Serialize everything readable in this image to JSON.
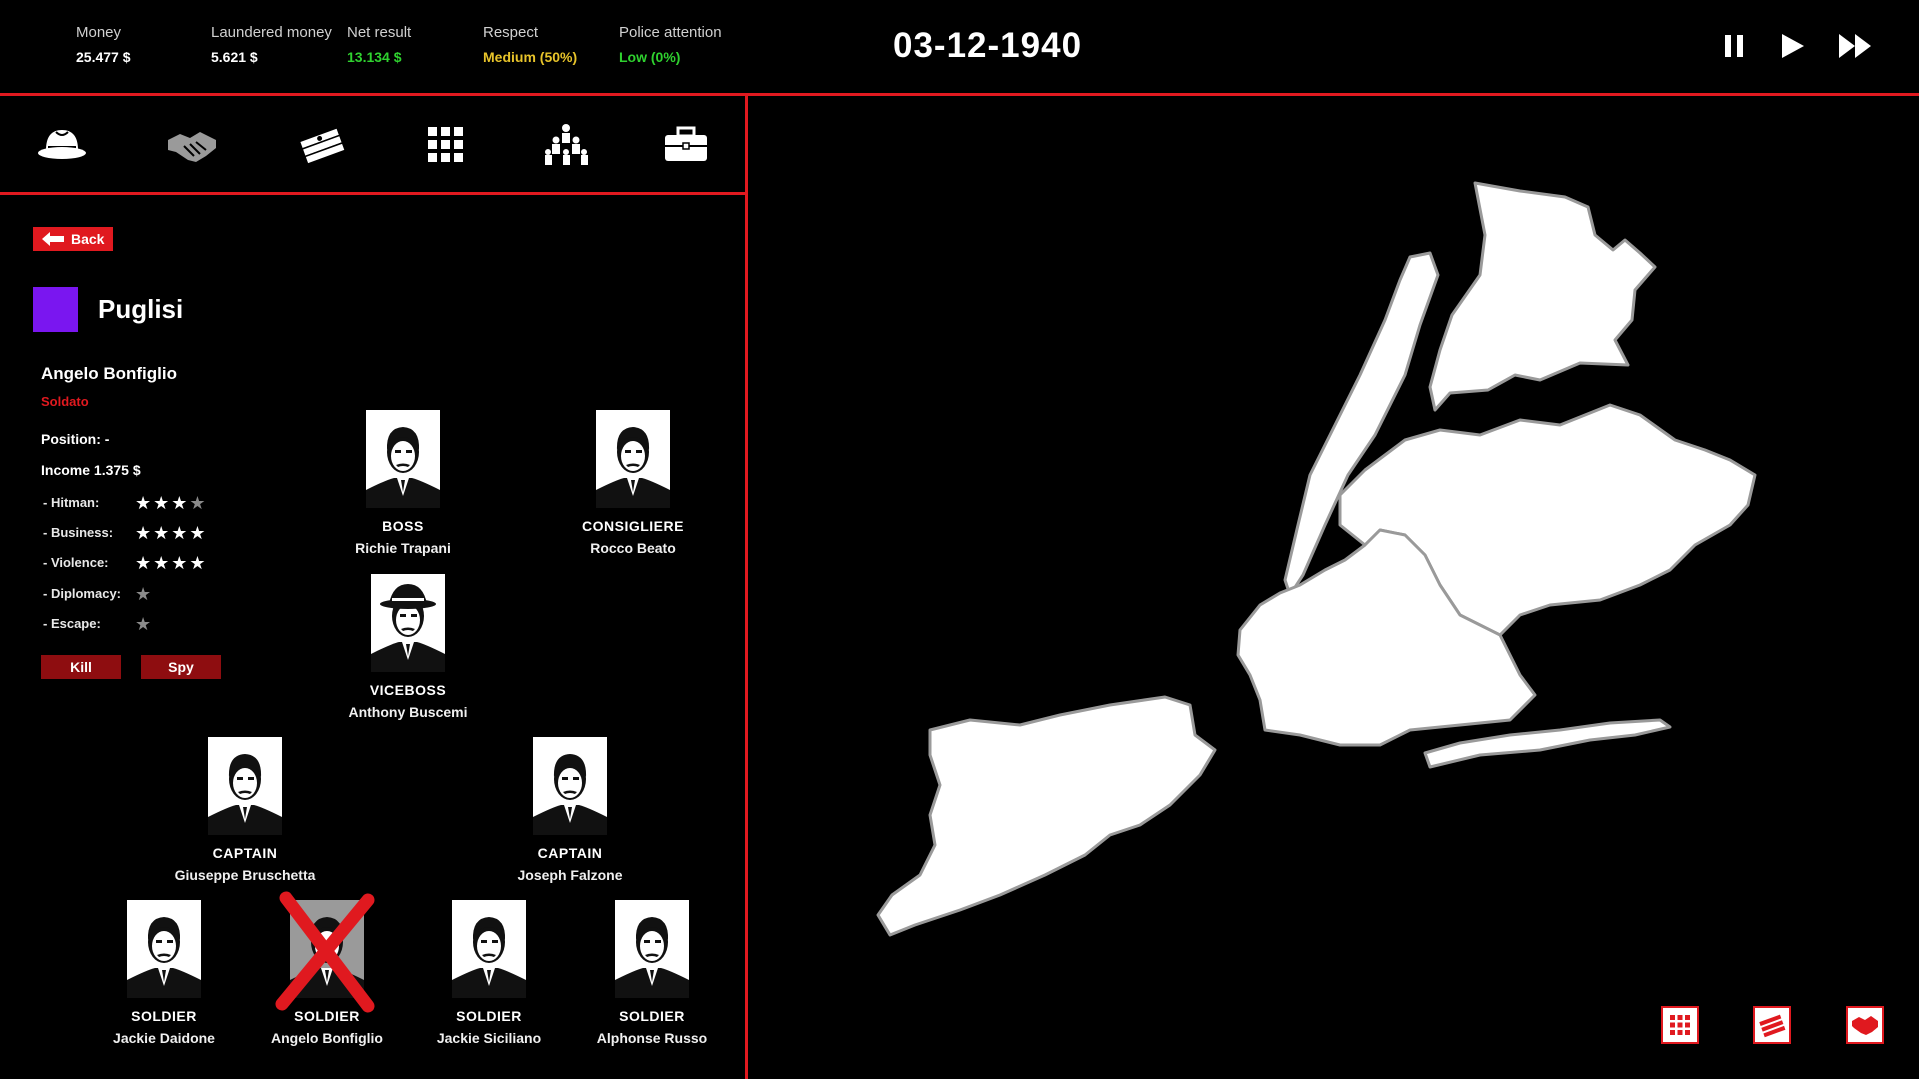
{
  "topbar": {
    "stats": [
      {
        "label": "Money",
        "value": "25.477 $",
        "color": "#ffffff"
      },
      {
        "label": "Laundered money",
        "value": "5.621 $",
        "color": "#ffffff"
      },
      {
        "label": "Net result",
        "value": "13.134 $",
        "color": "#2fd12f"
      },
      {
        "label": "Respect",
        "value": "Medium (50%)",
        "color": "#e8c42a"
      },
      {
        "label": "Police attention",
        "value": "Low (0%)",
        "color": "#2fd12f"
      }
    ],
    "date": "03-12-1940"
  },
  "icons": {
    "controls": [
      "pause-icon",
      "play-icon",
      "fast-forward-icon"
    ],
    "nav": [
      "fedora-hat-icon",
      "handshake-icon",
      "money-stack-icon",
      "grid-icon",
      "family-tree-icon",
      "briefcase-icon"
    ],
    "map_buttons": [
      "grid-icon",
      "money-stack-icon",
      "handshake-icon"
    ]
  },
  "back_label": "Back",
  "family": {
    "name": "Puglisi",
    "color": "#7a16f0"
  },
  "selected": {
    "name": "Angelo Bonfiglio",
    "rank": "Soldato",
    "position": "Position: -",
    "income": "Income 1.375 $",
    "skills": [
      {
        "label": "- Hitman:",
        "value": 3,
        "max": 4
      },
      {
        "label": "- Business:",
        "value": 4,
        "max": 4
      },
      {
        "label": "- Violence:",
        "value": 4,
        "max": 4
      },
      {
        "label": "- Diplomacy:",
        "value": 0,
        "max": 1
      },
      {
        "label": "- Escape:",
        "value": 0,
        "max": 1
      }
    ],
    "actions": {
      "kill": "Kill",
      "spy": "Spy"
    }
  },
  "org": [
    {
      "role": "BOSS",
      "name": "Richie Trapani",
      "dead": false
    },
    {
      "role": "CONSIGLIERE",
      "name": "Rocco Beato",
      "dead": false
    },
    {
      "role": "VICEBOSS",
      "name": "Anthony Buscemi",
      "dead": false
    },
    {
      "role": "CAPTAIN",
      "name": "Giuseppe Bruschetta",
      "dead": false
    },
    {
      "role": "CAPTAIN",
      "name": "Joseph Falzone",
      "dead": false
    },
    {
      "role": "SOLDIER",
      "name": "Jackie Daidone",
      "dead": false
    },
    {
      "role": "SOLDIER",
      "name": "Angelo Bonfiglio",
      "dead": true
    },
    {
      "role": "SOLDIER",
      "name": "Jackie Siciliano",
      "dead": false
    },
    {
      "role": "SOLDIER",
      "name": "Alphonse Russo",
      "dead": false
    }
  ],
  "colors": {
    "accent": "#e0191f",
    "dark_red": "#8e0d10"
  }
}
